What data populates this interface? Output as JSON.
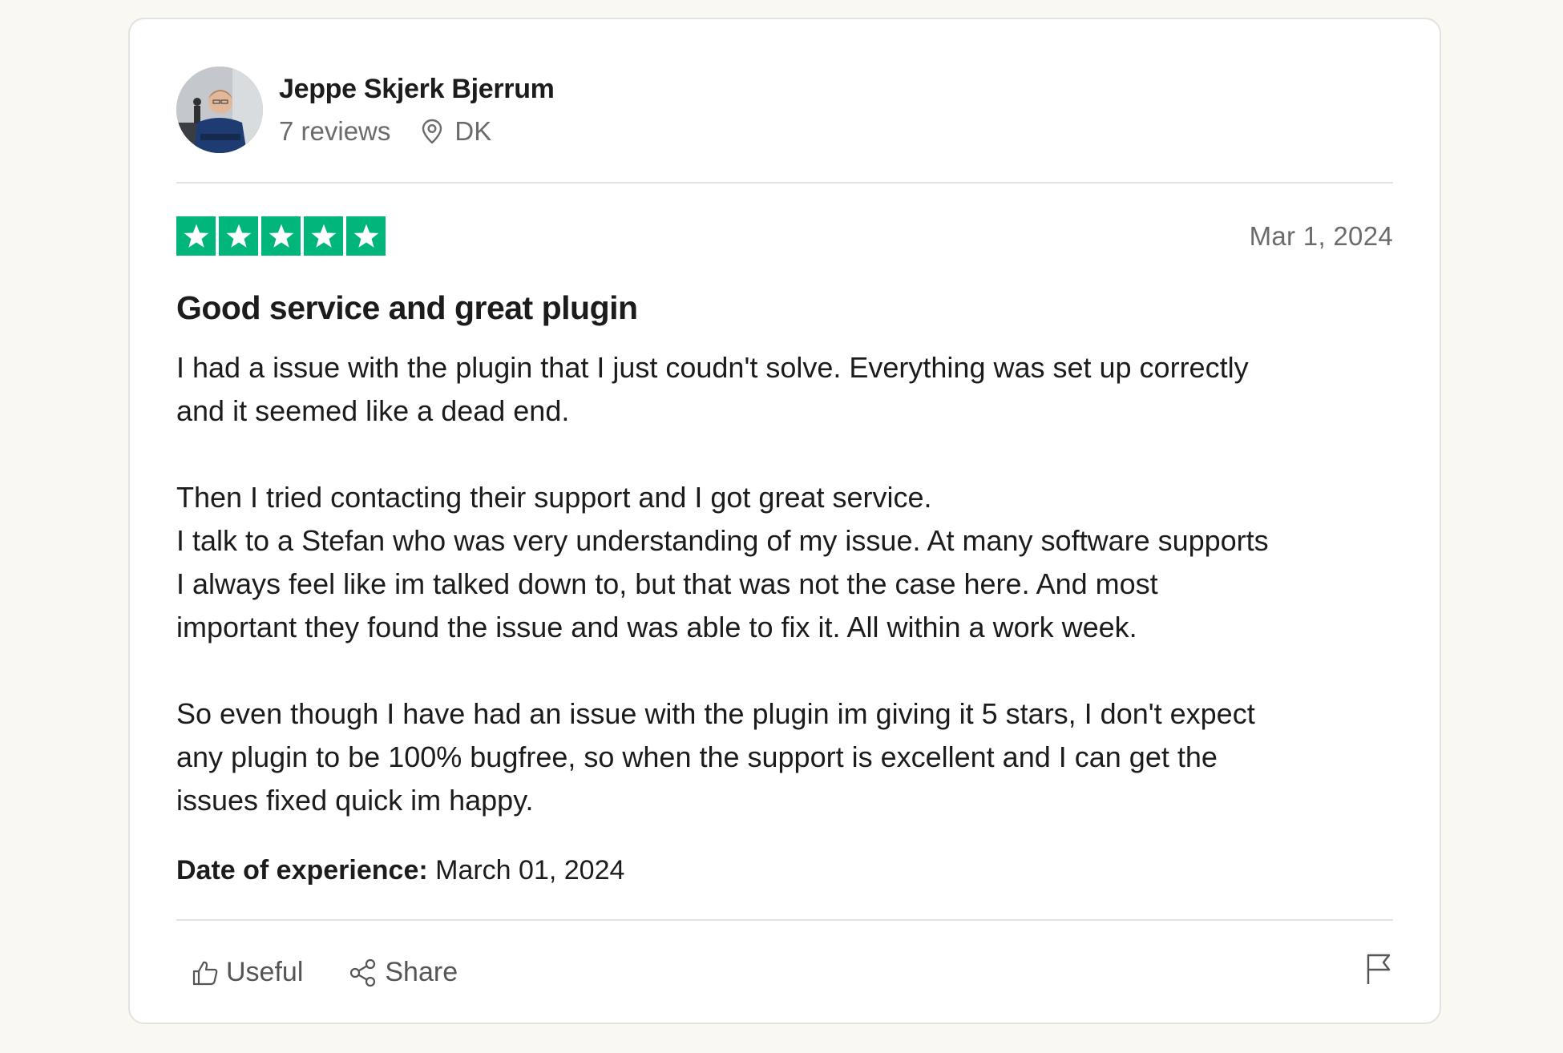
{
  "reviewer": {
    "name": "Jeppe Skjerk Bjerrum",
    "reviews_count": "7 reviews",
    "country": "DK",
    "avatar_icon": "reviewer-avatar-photo"
  },
  "rating": {
    "stars": 5,
    "max_stars": 5,
    "color": "#00b67a"
  },
  "review": {
    "date": "Mar 1, 2024",
    "title": "Good service and great plugin",
    "paragraphs": [
      "I had a issue with the plugin that I just coudn't solve. Everything was set up correctly\nand it seemed like a dead end.",
      "Then I tried contacting their support and I got great service.\nI talk to a Stefan who was very understanding of my issue. At many software supports\nI always feel like im talked down to, but that was not the case here. And most\nimportant they found the issue and was able to fix it. All within a work week.",
      "So even though I have had an issue with the plugin im giving it 5 stars, I don't expect\nany plugin to be 100% bugfree, so when the support is excellent and I can get the\nissues fixed quick im happy."
    ],
    "experience_label": "Date of experience:",
    "experience_date": "March 01, 2024"
  },
  "actions": {
    "useful_label": "Useful",
    "share_label": "Share",
    "useful_icon": "thumbs-up-icon",
    "share_icon": "share-icon",
    "flag_icon": "flag-icon"
  }
}
